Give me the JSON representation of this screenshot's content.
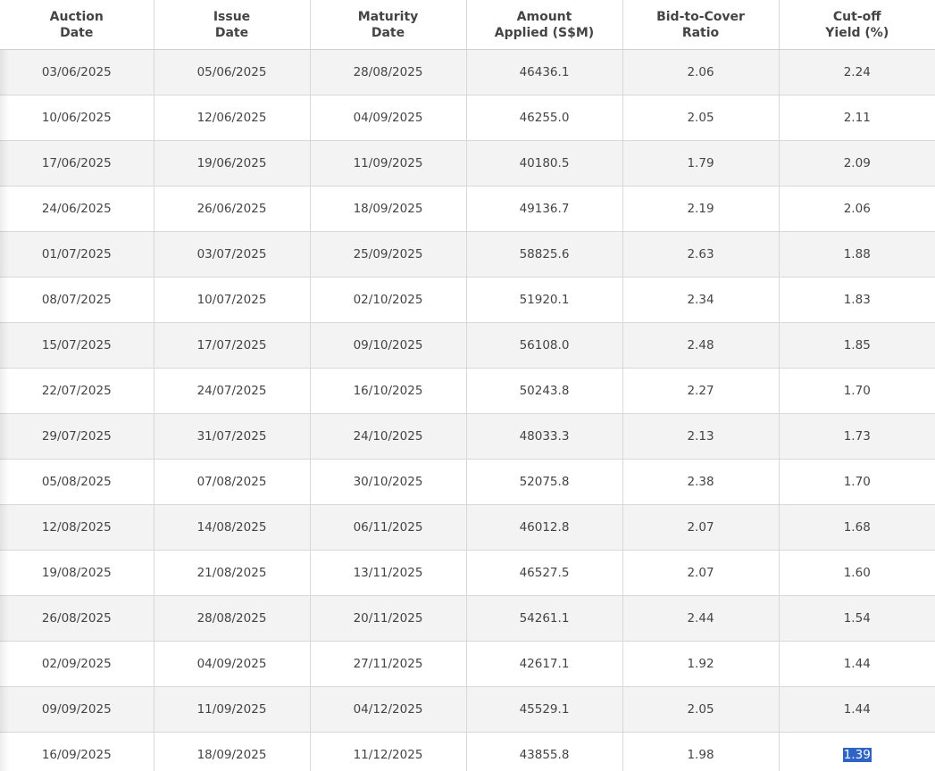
{
  "headers": [
    [
      "Auction",
      "Date"
    ],
    [
      "Issue",
      "Date"
    ],
    [
      "Maturity",
      "Date"
    ],
    [
      "Amount",
      "Applied (S$M)"
    ],
    [
      "Bid-to-Cover",
      "Ratio"
    ],
    [
      "Cut-off",
      "Yield (%)"
    ]
  ],
  "rows": [
    [
      "03/06/2025",
      "05/06/2025",
      "28/08/2025",
      "46436.1",
      "2.06",
      "2.24"
    ],
    [
      "10/06/2025",
      "12/06/2025",
      "04/09/2025",
      "46255.0",
      "2.05",
      "2.11"
    ],
    [
      "17/06/2025",
      "19/06/2025",
      "11/09/2025",
      "40180.5",
      "1.79",
      "2.09"
    ],
    [
      "24/06/2025",
      "26/06/2025",
      "18/09/2025",
      "49136.7",
      "2.19",
      "2.06"
    ],
    [
      "01/07/2025",
      "03/07/2025",
      "25/09/2025",
      "58825.6",
      "2.63",
      "1.88"
    ],
    [
      "08/07/2025",
      "10/07/2025",
      "02/10/2025",
      "51920.1",
      "2.34",
      "1.83"
    ],
    [
      "15/07/2025",
      "17/07/2025",
      "09/10/2025",
      "56108.0",
      "2.48",
      "1.85"
    ],
    [
      "22/07/2025",
      "24/07/2025",
      "16/10/2025",
      "50243.8",
      "2.27",
      "1.70"
    ],
    [
      "29/07/2025",
      "31/07/2025",
      "24/10/2025",
      "48033.3",
      "2.13",
      "1.73"
    ],
    [
      "05/08/2025",
      "07/08/2025",
      "30/10/2025",
      "52075.8",
      "2.38",
      "1.70"
    ],
    [
      "12/08/2025",
      "14/08/2025",
      "06/11/2025",
      "46012.8",
      "2.07",
      "1.68"
    ],
    [
      "19/08/2025",
      "21/08/2025",
      "13/11/2025",
      "46527.5",
      "2.07",
      "1.60"
    ],
    [
      "26/08/2025",
      "28/08/2025",
      "20/11/2025",
      "54261.1",
      "2.44",
      "1.54"
    ],
    [
      "02/09/2025",
      "04/09/2025",
      "27/11/2025",
      "42617.1",
      "1.92",
      "1.44"
    ],
    [
      "09/09/2025",
      "11/09/2025",
      "04/12/2025",
      "45529.1",
      "2.05",
      "1.44"
    ],
    [
      "16/09/2025",
      "18/09/2025",
      "11/12/2025",
      "43855.8",
      "1.98",
      "1.39"
    ]
  ],
  "selection": {
    "row": 15,
    "col": 5
  },
  "colors": {
    "row_alt": "#f3f3f3",
    "border": "#d8d8d8",
    "selection": "#2f64c6"
  }
}
